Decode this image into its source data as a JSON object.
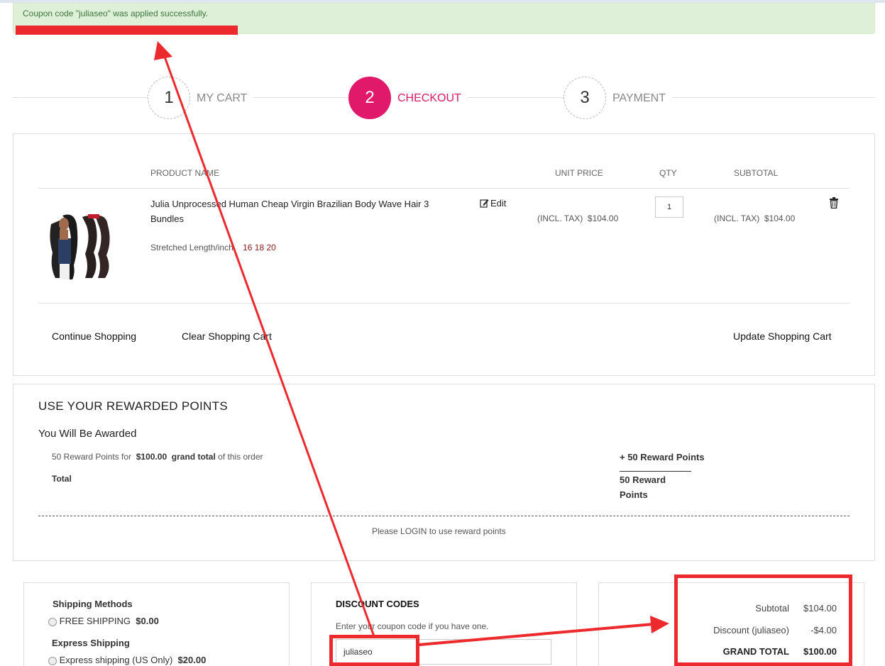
{
  "message": {
    "success": "Coupon code \"juliaseo\" was applied successfully."
  },
  "steps": [
    {
      "number": "1",
      "label": "MY CART"
    },
    {
      "number": "2",
      "label": "CHECKOUT"
    },
    {
      "number": "3",
      "label": "PAYMENT"
    }
  ],
  "cart": {
    "headers": {
      "product": "PRODUCT NAME",
      "unit_price": "UNIT PRICE",
      "qty": "QTY",
      "subtotal": "SUBTOTAL"
    },
    "item": {
      "name": "Julia Unprocessed Human Cheap Virgin Brazilian Body Wave Hair 3 Bundles",
      "option_label": "Stretched Length/inch",
      "option_value": "16 18 20",
      "edit_label": "Edit",
      "tax_label": "(INCL. TAX)",
      "unit_price": "$104.00",
      "qty": "1",
      "subtotal": "$104.00"
    },
    "actions": {
      "continue": "Continue Shopping",
      "clear": "Clear Shopping Cart",
      "update": "Update Shopping Cart"
    }
  },
  "rewards": {
    "title": "USE YOUR REWARDED POINTS",
    "subtitle": "You Will Be Awarded",
    "line_prefix": "50 Reward Points for",
    "line_amount": "$100.00",
    "line_bold": "grand total",
    "line_suffix": "of this order",
    "plus_points": "+ 50 Reward Points",
    "total_label": "Total",
    "total_value_1": "50 Reward",
    "total_value_2": "Points",
    "login_note": "Please LOGIN to use reward points"
  },
  "shipping": {
    "title": "Shipping Methods",
    "free_label": "FREE SHIPPING",
    "free_price": "$0.00",
    "express_title": "Express Shipping",
    "express_label": "Express shipping (US Only)",
    "express_price": "$20.00"
  },
  "discount": {
    "title": "DISCOUNT CODES",
    "hint": "Enter your coupon code if you have one.",
    "value": "juliaseo"
  },
  "totals": {
    "subtotal_label": "Subtotal",
    "subtotal_value": "$104.00",
    "discount_label": "Discount (juliaseo)",
    "discount_value": "-$4.00",
    "grand_label": "GRAND TOTAL",
    "grand_value": "$100.00"
  },
  "colors": {
    "accent": "#e0196b",
    "annotation": "#ec2a2e",
    "success_bg": "#dff0d8"
  }
}
